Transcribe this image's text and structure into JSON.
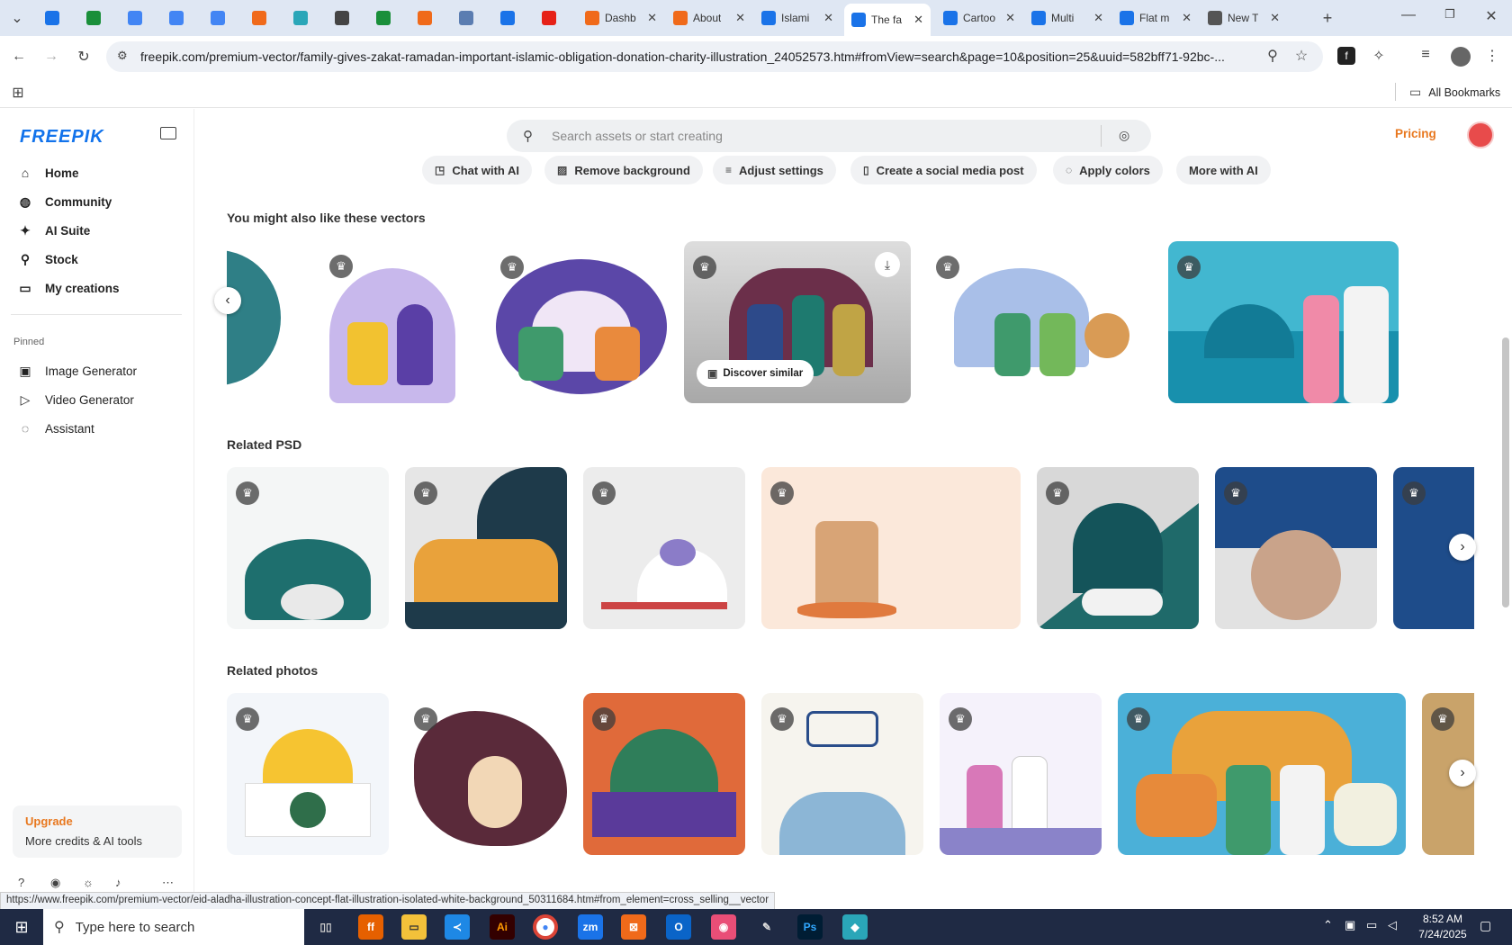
{
  "browser": {
    "tabs": [
      {
        "label": "",
        "color": "#1a73e8"
      },
      {
        "label": "",
        "color": "#1a8f3a"
      },
      {
        "label": "",
        "color": "#4285f4"
      },
      {
        "label": "",
        "color": "#4285f4"
      },
      {
        "label": "",
        "color": "#4285f4"
      },
      {
        "label": "",
        "color": "#f06a1a"
      },
      {
        "label": "",
        "color": "#2aa6b8"
      },
      {
        "label": "",
        "color": "#444444"
      },
      {
        "label": "",
        "color": "#1a8f3a"
      },
      {
        "label": "",
        "color": "#f06a1a"
      },
      {
        "label": "",
        "color": "#5b7db1"
      },
      {
        "label": "",
        "color": "#1a73e8"
      },
      {
        "label": "",
        "color": "#e62117"
      },
      {
        "label": "Dashb",
        "color": "#f06a1a"
      },
      {
        "label": "About",
        "color": "#f06a1a"
      },
      {
        "label": "Islami",
        "color": "#1a73e8"
      },
      {
        "label": "The fa",
        "color": "#1a73e8"
      },
      {
        "label": "Cartoo",
        "color": "#1a73e8"
      },
      {
        "label": "Multi",
        "color": "#1a73e8"
      },
      {
        "label": "Flat m",
        "color": "#1a73e8"
      },
      {
        "label": "New T",
        "color": "#555555"
      }
    ],
    "url": "freepik.com/premium-vector/family-gives-zakat-ramadan-important-islamic-obligation-donation-charity-illustration_24052573.htm#fromView=search&page=10&position=25&uuid=582bff71-92bc-...",
    "all_bookmarks": "All Bookmarks",
    "status_url": "https://www.freepik.com/premium-vector/eid-aladha-illustration-concept-flat-illustration-isolated-white-background_50311684.htm#from_element=cross_selling__vector"
  },
  "sidebar": {
    "logo": "FREEPIK",
    "nav": [
      {
        "label": "Home",
        "icon": "home-icon",
        "glyph": "⌂"
      },
      {
        "label": "Community",
        "icon": "globe-icon",
        "glyph": "◍"
      },
      {
        "label": "AI Suite",
        "icon": "sparkle-icon",
        "glyph": "✦"
      },
      {
        "label": "Stock",
        "icon": "search-icon",
        "glyph": "⚲"
      },
      {
        "label": "My creations",
        "icon": "folder-icon",
        "glyph": "▭"
      }
    ],
    "pinned_title": "Pinned",
    "pinned": [
      {
        "label": "Image Generator",
        "icon": "image-icon",
        "glyph": "▣"
      },
      {
        "label": "Video Generator",
        "icon": "video-icon",
        "glyph": "▷"
      },
      {
        "label": "Assistant",
        "icon": "assistant-icon",
        "glyph": "◌"
      }
    ],
    "upgrade_title": "Upgrade",
    "upgrade_text": "More credits & AI tools"
  },
  "header": {
    "search_placeholder": "Search assets or start creating",
    "pricing": "Pricing"
  },
  "chips": [
    "Chat with AI",
    "Remove background",
    "Adjust settings",
    "Create a social media post",
    "Apply colors",
    "More with AI"
  ],
  "vectors_section": {
    "title": "You might also like these vectors",
    "discover": "Discover similar"
  },
  "psd_section": {
    "title": "Related PSD"
  },
  "photos_section": {
    "title": "Related photos"
  },
  "taskbar": {
    "search_placeholder": "Type here to search",
    "time": "8:52 AM",
    "date": "7/24/2025"
  }
}
